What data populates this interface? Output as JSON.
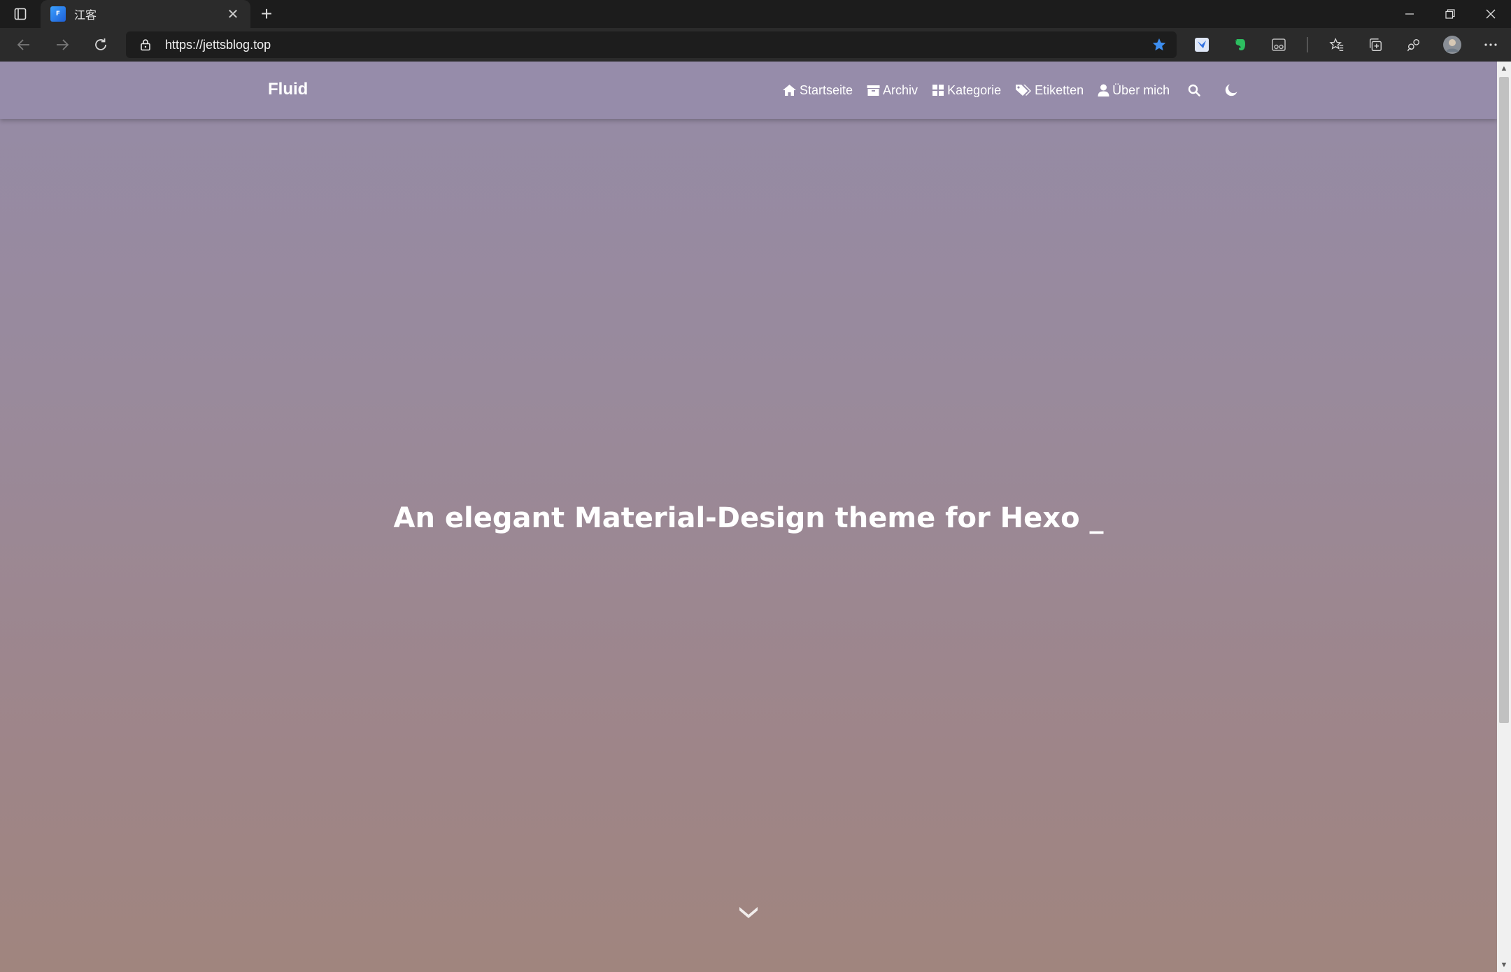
{
  "browser": {
    "tab": {
      "title": "江客",
      "favicon": "site-favicon"
    },
    "address": {
      "url": "https://jettsblog.top"
    },
    "window_controls": [
      "minimize",
      "restore",
      "close"
    ]
  },
  "site": {
    "brand": "Fluid",
    "nav": [
      {
        "label": "Startseite",
        "icon": "home-icon"
      },
      {
        "label": "Archiv",
        "icon": "archive-icon"
      },
      {
        "label": "Kategorie",
        "icon": "category-icon"
      },
      {
        "label": "Etiketten",
        "icon": "tags-icon"
      },
      {
        "label": "Über mich",
        "icon": "user-icon"
      }
    ],
    "hero": {
      "title": "An elegant Material-Design theme for Hexo _"
    }
  },
  "colors": {
    "nav_bg": "#968caa",
    "hero_top": "#958ba6",
    "hero_bottom": "#a0857e",
    "favorite_star": "#3d8ef0",
    "evernote_green": "#2dbe60"
  }
}
